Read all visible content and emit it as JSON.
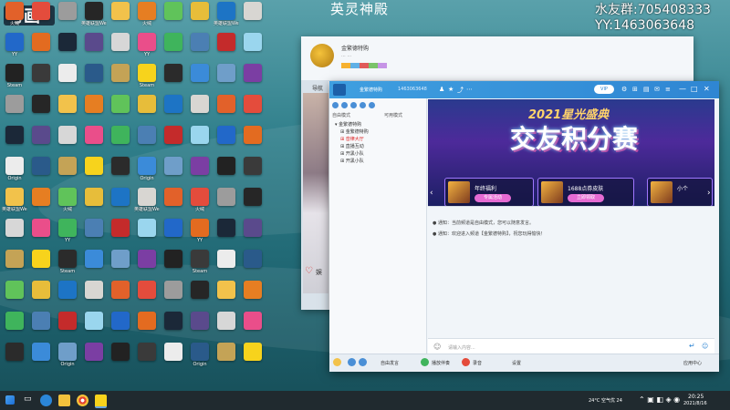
{
  "overlay": {
    "title": "英灵神殿",
    "group_line1": "水友群:705408333",
    "group_line2": "YY:1463063648"
  },
  "desktop_icons": [
    {
      "label": "火绒",
      "color": "#e2612a"
    },
    {
      "label": "YY",
      "color": "#f7d31c"
    },
    {
      "label": "Steam",
      "color": "#1b2838"
    },
    {
      "label": "",
      "color": "#d8d6d2"
    },
    {
      "label": "",
      "color": "#c4a356"
    },
    {
      "label": "Origin",
      "color": "#e36b20"
    },
    {
      "label": "英雄联盟WeGame",
      "color": "#1d74c5"
    },
    {
      "label": "",
      "color": "#2a5a8a"
    },
    {
      "label": "",
      "color": "#2268c9"
    },
    {
      "label": "",
      "color": "#e7bd3a"
    },
    {
      "label": "",
      "color": "#ececec"
    },
    {
      "label": "",
      "color": "#9ad6ee"
    },
    {
      "label": "",
      "color": "#60c35a"
    },
    {
      "label": "",
      "color": "#3a3a3a"
    },
    {
      "label": "",
      "color": "#c42b2b"
    },
    {
      "label": "",
      "color": "#e67e22"
    },
    {
      "label": "",
      "color": "#222"
    },
    {
      "label": "",
      "color": "#4b7fb3"
    },
    {
      "label": "",
      "color": "#f2c24b"
    },
    {
      "label": "",
      "color": "#7b3ea3"
    },
    {
      "label": "",
      "color": "#3fb45c"
    },
    {
      "label": "",
      "color": "#262626"
    },
    {
      "label": "",
      "color": "#6f9ec9"
    },
    {
      "label": "",
      "color": "#ea4e8a"
    },
    {
      "label": "",
      "color": "#9c9c9c"
    },
    {
      "label": "",
      "color": "#3b8bd9"
    },
    {
      "label": "",
      "color": "#d7d7d7"
    },
    {
      "label": "",
      "color": "#e44c3c"
    },
    {
      "label": "",
      "color": "#2b2b2b"
    },
    {
      "label": "",
      "color": "#5a4a8c"
    }
  ],
  "profile_window": {
    "name": "金繁德特购",
    "tab": "导航",
    "heart_label": "娱"
  },
  "chat_window": {
    "channel_name": "金繁德特购",
    "channel_id": "1463063648",
    "vip": "VIP",
    "mode_label": "自由模式",
    "mode_right": "可用模式",
    "tree": [
      {
        "label": "金繁德特购",
        "cls": ""
      },
      {
        "label": "金繁德特购",
        "cls": ""
      },
      {
        "label": "音律大厅",
        "cls": "red"
      },
      {
        "label": "直播互动",
        "cls": ""
      },
      {
        "label": "开黑小队",
        "cls": ""
      },
      {
        "label": "开黑小队",
        "cls": ""
      }
    ],
    "banner_title": "2021星光盛典",
    "banner_main": "交友积分赛",
    "banner_cards": [
      {
        "title": "年终福利",
        "button": "专属活动"
      },
      {
        "title": "1688点券皮肤",
        "button": "立即领取"
      },
      {
        "title": "小个",
        "button": ""
      }
    ],
    "messages": [
      "● 通知：当前频道是自由模式，您可以随意发言。",
      "● 通知：欢迎进入频道【金繁德特购】，祝您玩得愉快！"
    ],
    "input_placeholder": "请输入内容...",
    "bottom": {
      "mic": "自由发言",
      "play": "播放伴奏",
      "record": "录音",
      "settings": "设置",
      "app": "应用中心"
    }
  },
  "taskbar": {
    "weather": "24°C 空气优 24",
    "time": "20:25",
    "date": "2021/8/16"
  }
}
